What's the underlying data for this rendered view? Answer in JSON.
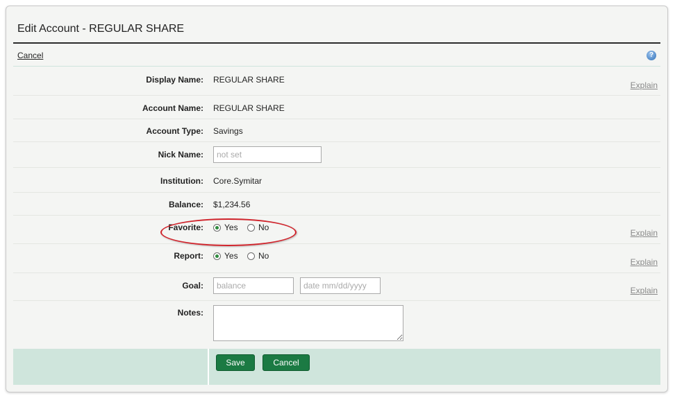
{
  "page": {
    "title": "Edit Account - REGULAR SHARE",
    "cancel_link": "Cancel",
    "help_icon_glyph": "?"
  },
  "fields": {
    "display_name": {
      "label": "Display Name:",
      "value": "REGULAR SHARE",
      "explain": "Explain"
    },
    "account_name": {
      "label": "Account Name:",
      "value": "REGULAR SHARE"
    },
    "account_type": {
      "label": "Account Type:",
      "value": "Savings"
    },
    "nick_name": {
      "label": "Nick Name:",
      "placeholder": "not set",
      "value": ""
    },
    "institution": {
      "label": "Institution:",
      "value": "Core.Symitar"
    },
    "balance": {
      "label": "Balance:",
      "value": "$1,234.56"
    },
    "favorite": {
      "label": "Favorite:",
      "yes": "Yes",
      "no": "No",
      "selected": "Yes",
      "explain": "Explain"
    },
    "report": {
      "label": "Report:",
      "yes": "Yes",
      "no": "No",
      "selected": "Yes",
      "explain": "Explain"
    },
    "goal": {
      "label": "Goal:",
      "balance_placeholder": "balance",
      "date_placeholder": "date mm/dd/yyyy",
      "explain": "Explain"
    },
    "notes": {
      "label": "Notes:",
      "value": ""
    }
  },
  "buttons": {
    "save": "Save",
    "cancel": "Cancel"
  },
  "colors": {
    "accent": "#1b7a43",
    "footer_bg": "#cfe5dc",
    "highlight_oval": "#d0242c"
  }
}
